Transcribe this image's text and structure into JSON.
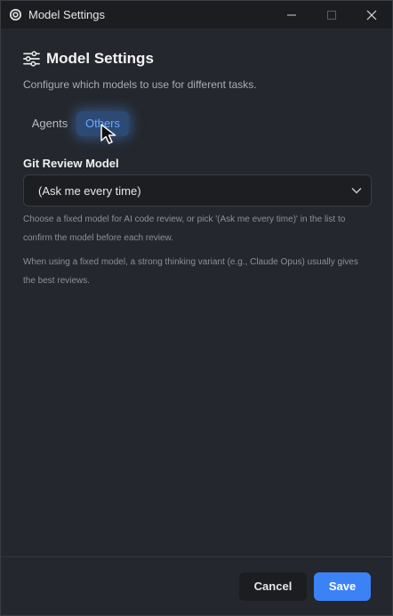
{
  "window": {
    "title": "Model Settings"
  },
  "header": {
    "title": "Model Settings",
    "subtitle": "Configure which models to use for different tasks."
  },
  "tabs": [
    {
      "label": "Agents",
      "active": false
    },
    {
      "label": "Others",
      "active": true
    }
  ],
  "git_review": {
    "label": "Git Review Model",
    "selected": "(Ask me every time)",
    "help_1": "Choose a fixed model for AI code review, or pick '(Ask me every time)' in the list to confirm the model before each review.",
    "help_2": "When using a fixed model, a strong thinking variant (e.g., Claude Opus) usually gives the best reviews."
  },
  "footer": {
    "cancel_label": "Cancel",
    "save_label": "Save"
  },
  "colors": {
    "accent": "#3b82f6",
    "active_tab_text": "#6aa9ff",
    "background": "#24272d"
  }
}
